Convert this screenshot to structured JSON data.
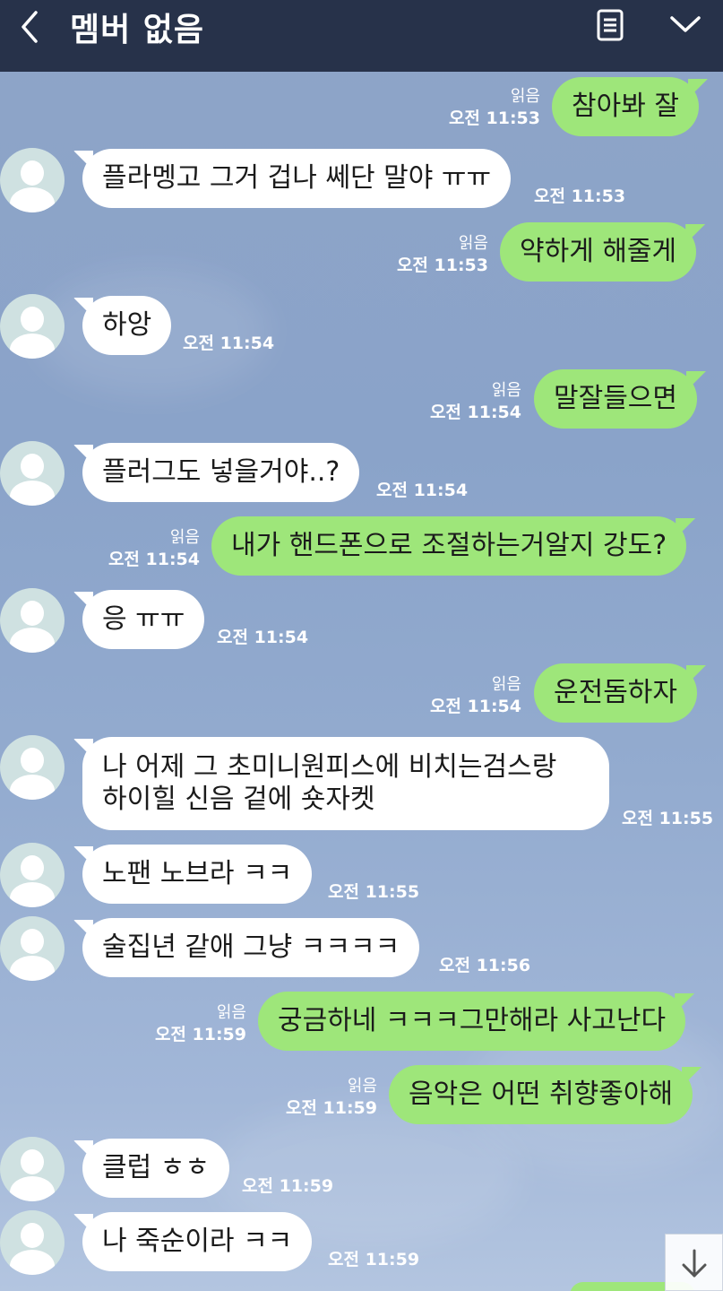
{
  "header": {
    "title": "멤버 없음",
    "back_icon": "chevron-left-icon",
    "menu_icon": "list-icon",
    "collapse_icon": "chevron-down-icon"
  },
  "colors": {
    "header_bg": "#27324a",
    "outgoing_bubble": "#9ee67a",
    "incoming_bubble": "#ffffff",
    "chat_bg": "#8ea4c8"
  },
  "messages": [
    {
      "dir": "out",
      "text": "참아봐 잘",
      "read": "읽음",
      "time": "오전 11:53"
    },
    {
      "dir": "in",
      "text": "플라멩고 그거 겁나 쎄단 말야 ㅠㅠ",
      "time": "오전 11:53"
    },
    {
      "dir": "out",
      "text": "약하게 해줄게",
      "read": "읽음",
      "time": "오전 11:53"
    },
    {
      "dir": "in",
      "text": "하앙",
      "time": "오전 11:54"
    },
    {
      "dir": "out",
      "text": "말잘들으면",
      "read": "읽음",
      "time": "오전 11:54"
    },
    {
      "dir": "in",
      "text": "플러그도 넣을거야..?",
      "time": "오전 11:54"
    },
    {
      "dir": "out",
      "text": "내가 핸드폰으로 조절하는거알지 강도?",
      "read": "읽음",
      "time": "오전 11:54"
    },
    {
      "dir": "in",
      "text": "응 ㅠㅠ",
      "time": "오전 11:54"
    },
    {
      "dir": "out",
      "text": "운전돔하자",
      "read": "읽음",
      "time": "오전 11:54"
    },
    {
      "dir": "in",
      "line1": "나 어제 그 초미니원피스에 비치는검스랑",
      "line2": "하이힐 신음 겉에 숏자켓",
      "time": "오전 11:55"
    },
    {
      "dir": "in",
      "text": "노팬 노브라 ㅋㅋ",
      "time": "오전 11:55"
    },
    {
      "dir": "in",
      "text": "술집년 같애 그냥 ㅋㅋㅋㅋ",
      "time": "오전 11:56"
    },
    {
      "dir": "out",
      "text": "궁금하네 ㅋㅋㅋ그만해라 사고난다",
      "read": "읽음",
      "time": "오전 11:59"
    },
    {
      "dir": "out",
      "text": "음악은 어떤 취향좋아해",
      "read": "읽음",
      "time": "오전 11:59"
    },
    {
      "dir": "in",
      "text": "클럽 ㅎㅎ",
      "time": "오전 11:59"
    },
    {
      "dir": "in",
      "text": "나 죽순이라 ㅋㅋ",
      "time": "오전 11:59"
    }
  ],
  "scroll_button_icon": "arrow-down-icon"
}
